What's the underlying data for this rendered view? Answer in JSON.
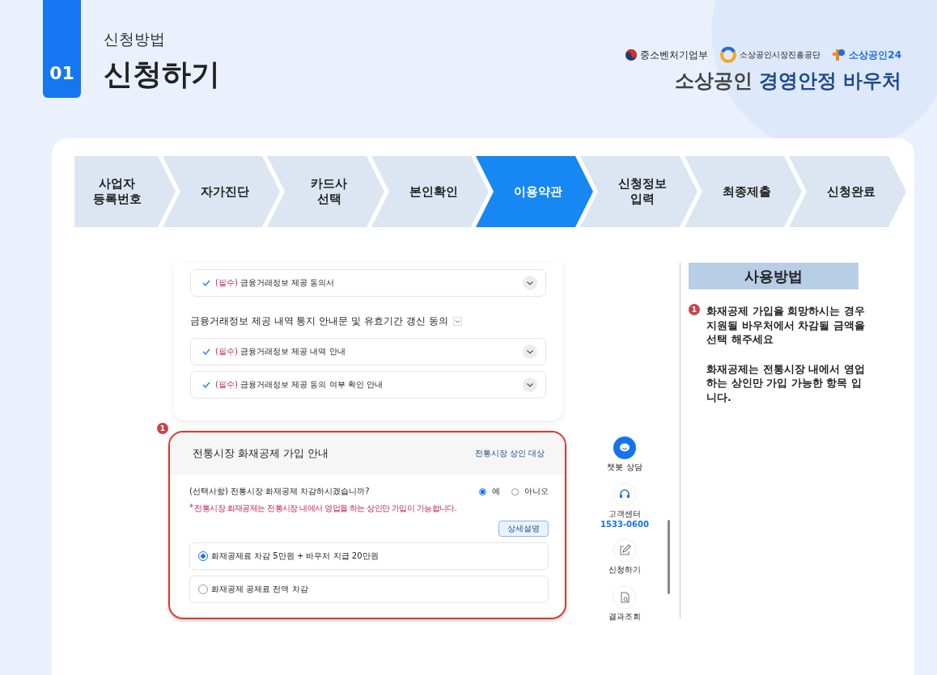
{
  "header": {
    "number": "01",
    "subtitle": "신청방법",
    "title": "신청하기"
  },
  "logos": [
    {
      "kind": "ministry",
      "text": "중소벤처기업부"
    },
    {
      "kind": "agency",
      "text": "소상공인시장진흥공단"
    },
    {
      "kind": "portal",
      "text": "소상공인24"
    }
  ],
  "brand": {
    "part_1": "소상공인",
    "part_2": "경영안정 바우처"
  },
  "steps": [
    {
      "label": "사업자\n등록번호",
      "selected": false
    },
    {
      "label": "자가진단",
      "selected": false
    },
    {
      "label": "카드사\n선택",
      "selected": false
    },
    {
      "label": "본인확인",
      "selected": false
    },
    {
      "label": "이용약관",
      "selected": true
    },
    {
      "label": "신청정보\n입력",
      "selected": false
    },
    {
      "label": "최종제출",
      "selected": false
    },
    {
      "label": "신청완료",
      "selected": false
    }
  ],
  "consent": {
    "top_items": [
      {
        "tag": "(필수)",
        "text": "금융거래정보 제공 동의서",
        "checked": true
      }
    ],
    "section_title": "금융거래정보 제공 내역 통지 안내문 및 유효기간 갱신 동의",
    "items": [
      {
        "tag": "(필수)",
        "text": "금융거래정보 제공 내역 안내",
        "checked": true
      },
      {
        "tag": "(필수)",
        "text": "금융거래정보 제공 동의 여부 확인 안내",
        "checked": true
      }
    ]
  },
  "fire_insurance": {
    "marker": "1",
    "title": "전통시장 화재공제 가입 안내",
    "tag": "전통시장 상인 대상",
    "question": "(선택사항) 전통시장 화재공제 차감하시겠습니까?",
    "answers": [
      {
        "label": "예",
        "selected": true
      },
      {
        "label": "아니오",
        "selected": false
      }
    ],
    "note_mark": "*",
    "note": "전통시장 화재공제는 전통시장 내에서 영업을 하는 상인만 가입이 가능합니다.",
    "detail_button": "상세설명",
    "options": [
      {
        "label": "화재공제료 차감 5만원 + 바우처 지급 20만원",
        "selected": true
      },
      {
        "label": "화재공제 공제료 전액 차감",
        "selected": false
      }
    ]
  },
  "quick_menu": [
    {
      "kind": "chat",
      "label": "챗봇 상담"
    },
    {
      "kind": "support",
      "label": "고객센터",
      "phone": "1533-0600"
    },
    {
      "kind": "apply",
      "label": "신청하기"
    },
    {
      "kind": "result",
      "label": "결과조회"
    }
  ],
  "guide": {
    "title": "사용방법",
    "marker": "1",
    "paragraphs": [
      "화재공제 가입을 희망하시는 경우 지원될 바우처에서 차감될 금액을 선택 해주세요",
      "화재공제는 전통시장 내에서 영업 하는 상인만 가입 가능한 항목 입니다."
    ]
  }
}
